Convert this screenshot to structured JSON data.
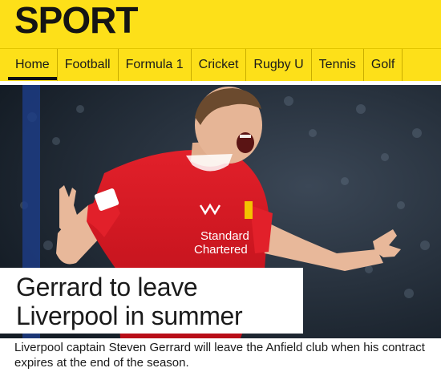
{
  "header": {
    "logo_text": "SPORT"
  },
  "nav": {
    "items": [
      {
        "label": "Home",
        "active": true
      },
      {
        "label": "Football"
      },
      {
        "label": "Formula 1"
      },
      {
        "label": "Cricket"
      },
      {
        "label": "Rugby U"
      },
      {
        "label": "Tennis"
      },
      {
        "label": "Golf"
      }
    ]
  },
  "story": {
    "headline": "Gerrard to leave Liverpool in summer",
    "summary": "Liverpool captain Steven Gerrard will leave the Anfield club when his contract expires at the end of the season.",
    "shirt_sponsor_line1": "Standard",
    "shirt_sponsor_line2": "Chartered"
  },
  "colors": {
    "brand_yellow": "#fde019",
    "shirt_red": "#d4121c",
    "text_dark": "#1a1a1a"
  }
}
